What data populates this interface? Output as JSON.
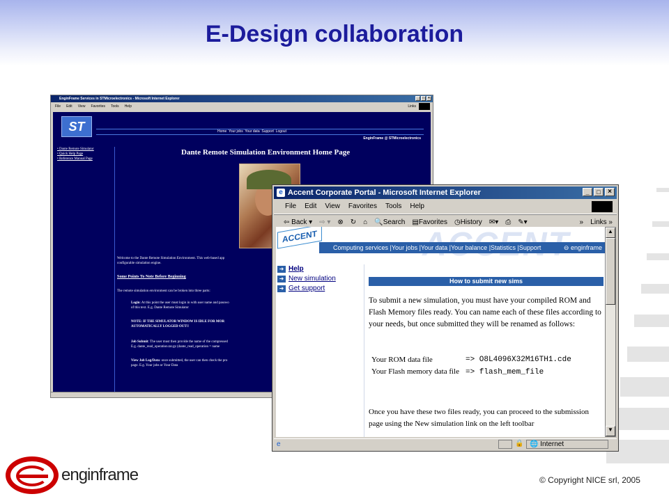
{
  "slide": {
    "title": "E-Design collaboration",
    "copyright": "© Copyright NICE srl, 2005",
    "logo_text": "enginframe"
  },
  "win1": {
    "title": "EnginFrame Services in STMicroelectronics - Microsoft Internet Explorer",
    "menu": [
      "File",
      "Edit",
      "View",
      "Favorites",
      "Tools",
      "Help"
    ],
    "links": "Links",
    "nav": "Home  Your jobs  Your data  Support  Logout",
    "brand": "EnginFrame @ STMicroelectronics",
    "logo": "ST",
    "side": [
      "Dante Remote Simulator",
      "Quick Help Page",
      "Reference Manual Page"
    ],
    "heading": "Dante Remote Simulation Environment Home Page",
    "p1": "Welcome to the Dante Remote Simulation Environment. This web-based app",
    "p1b": "configurable simulation engine.",
    "points_title": "Some Points To Note Before Beginning",
    "p2": "The remote simulation environment can be broken into three parts:",
    "login_b": "Login",
    "login": ": At this point the user must login in with user name and passwo",
    "login2": "of this text. E.g. Dante Remote Simulator",
    "note": "NOTE: IF THE SIMULATOR WINDOW IS IDLE FOR MOR",
    "note2": "AUTOMATICALLY LOGGED OUT!!",
    "job_b": "Job Submit",
    "job": ": The user must then provide the name of the compressed",
    "job2": "E.g. dante_read_operation.tar.gz (dante_read_operation = name",
    "view_b": "View Job Log/Data",
    "view": ": once submitted, the user can then check the pro",
    "view2": "page. E.g. Your jobs or Your Data"
  },
  "win2": {
    "title": "Accent Corporate Portal - Microsoft Internet Explorer",
    "menu": [
      "File",
      "Edit",
      "View",
      "Favorites",
      "Tools",
      "Help"
    ],
    "toolbar": {
      "back": "Back",
      "search": "Search",
      "favorites": "Favorites",
      "history": "History",
      "links": "Links"
    },
    "accent_logo": "ACCENT",
    "watermark": "ACCENT",
    "nav": [
      "Computing services",
      "Your jobs",
      "Your data",
      "Your balance",
      "Statistics",
      "Support"
    ],
    "ef_logo": "enginframe",
    "side": [
      "Help",
      "New simulation",
      "Get support"
    ],
    "box_title": "How to submit new sims",
    "intro": "To submit a new simulation, you must have your compiled ROM and Flash Memory files ready. You can name each of these files according to your needs, but once submitted they will be renamed as follows:",
    "rows": [
      {
        "label": "Your ROM data file",
        "value": "=> O8L4096X32M16TH1.cde"
      },
      {
        "label": "Your Flash memory data file",
        "value": "=> flash_mem_file"
      }
    ],
    "outro": "Once you have these two files ready, you can proceed to the submission page using the New simulation link on the left toolbar",
    "status": "Internet"
  },
  "colors": {
    "title": "#1c1c9c",
    "ie_titlebar": "#0a246a",
    "st_bg": "#00005e",
    "accent_nav": "#2a5fa8",
    "logo_red": "#cc0000"
  }
}
